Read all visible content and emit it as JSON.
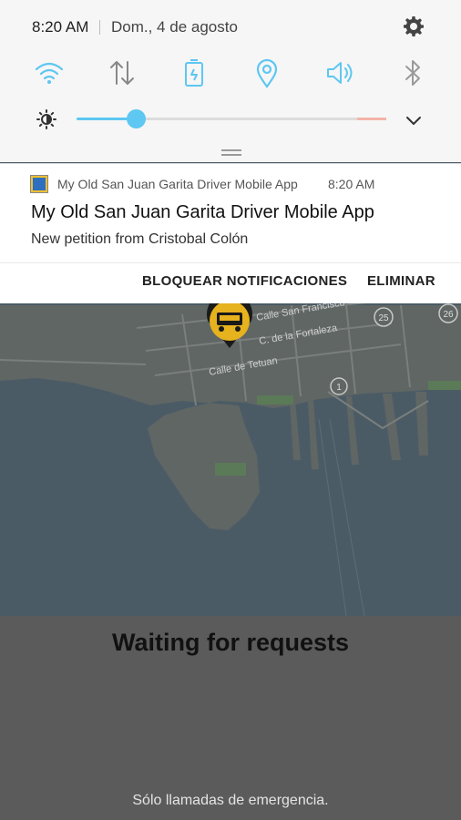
{
  "status": {
    "time": "8:20 AM",
    "date": "Dom., 4 de agosto"
  },
  "quick_settings": {
    "icons": [
      "wifi-icon",
      "data-transfer-icon",
      "power-saving-icon",
      "location-icon",
      "sound-icon",
      "bluetooth-icon"
    ],
    "brightness_level": 0.19,
    "accent_color": "#5ec7f2"
  },
  "notification": {
    "app_name": "My Old San Juan Garita Driver Mobile App",
    "time": "8:20 AM",
    "title": "My Old San Juan Garita Driver Mobile App",
    "text": "New petition from Cristobal Colón",
    "actions": {
      "block": "BLOQUEAR NOTIFICACIONES",
      "delete": "ELIMINAR"
    }
  },
  "map": {
    "streets": [
      "Calle San Francisco",
      "C. de la Fortaleza",
      "Calle de Tetuan"
    ],
    "route_badges": [
      "25",
      "26",
      "1"
    ]
  },
  "app": {
    "status_message": "Waiting for requests"
  },
  "lockscreen": {
    "emergency_text": "Sólo llamadas de emergencia."
  }
}
